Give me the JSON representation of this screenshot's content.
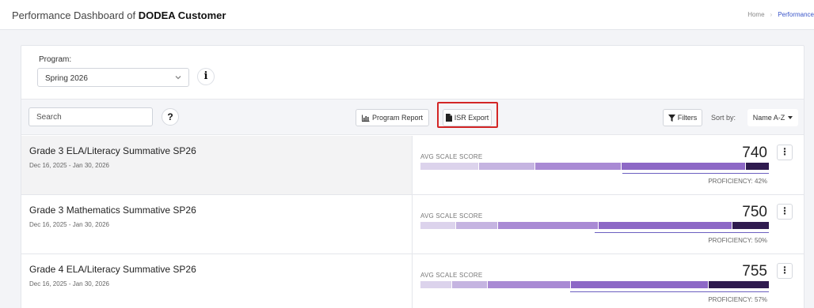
{
  "header": {
    "title_prefix": "Performance Dashboard of ",
    "title_org": "DODEA Customer",
    "breadcrumb_home": "Home",
    "breadcrumb_current": "Performance"
  },
  "program": {
    "label": "Program:",
    "selected": "Spring 2026",
    "info_icon": "i"
  },
  "toolbar": {
    "search_placeholder": "Search",
    "help_icon": "?",
    "program_report_label": "Program Report",
    "isr_export_label": "ISR Export",
    "filters_label": "Filters",
    "sort_label": "Sort by:",
    "sort_value": "Name A-Z"
  },
  "colors": {
    "bar_segments": [
      "#dcd3ec",
      "#c5b4e1",
      "#a98ad4",
      "#8d68c6",
      "#2f1b4f"
    ],
    "proficiency_line": "#6b5fc0",
    "highlight": "#d32626"
  },
  "assessments": [
    {
      "name": "Grade 3 ELA/Literacy Summative SP26",
      "dates": "Dec 16, 2025 - Jan 30, 2026",
      "metric_label": "AVG SCALE SCORE",
      "score": "740",
      "proficiency_text": "PROFICIENCY: 42%",
      "proficiency": 0.42,
      "segments": [
        0.168,
        0.16,
        0.248,
        0.358,
        0.066
      ]
    },
    {
      "name": "Grade 3 Mathematics Summative SP26",
      "dates": "Dec 16, 2025 - Jan 30, 2026",
      "metric_label": "AVG SCALE SCORE",
      "score": "750",
      "proficiency_text": "PROFICIENCY: 50%",
      "proficiency": 0.5,
      "segments": [
        0.1,
        0.12,
        0.29,
        0.385,
        0.105
      ]
    },
    {
      "name": "Grade 4 ELA/Literacy Summative SP26",
      "dates": "Dec 16, 2025 - Jan 30, 2026",
      "metric_label": "AVG SCALE SCORE",
      "score": "755",
      "proficiency_text": "PROFICIENCY: 57%",
      "proficiency": 0.57,
      "segments": [
        0.09,
        0.1,
        0.24,
        0.395,
        0.175
      ]
    }
  ]
}
